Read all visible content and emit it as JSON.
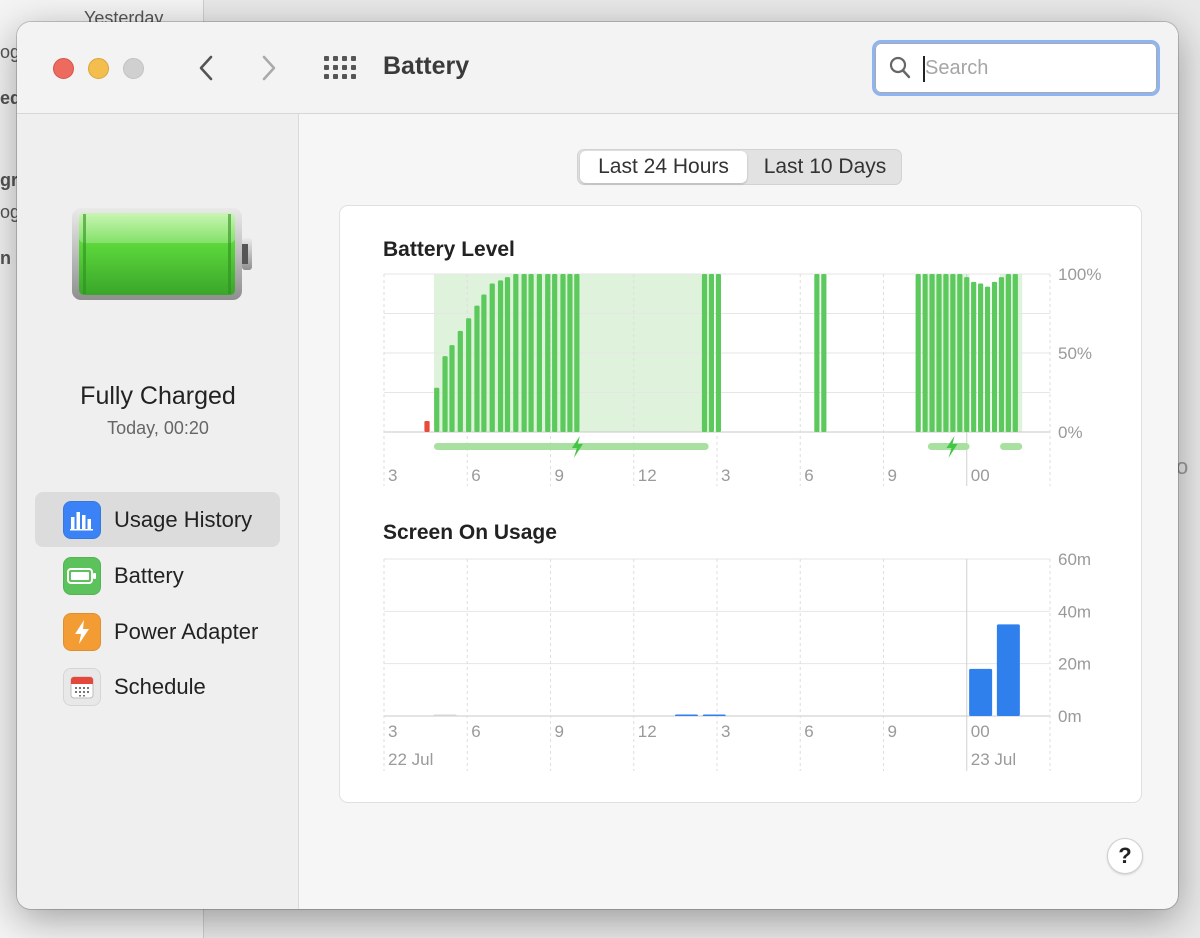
{
  "background": {
    "texts": [
      "Yesterday",
      "og",
      "ed",
      "gr",
      "og",
      "n",
      "o"
    ]
  },
  "window": {
    "title": "Battery",
    "search_placeholder": "Search"
  },
  "sidebar": {
    "status_title": "Fully Charged",
    "status_sub": "Today, 00:20",
    "items": [
      {
        "label": "Usage History",
        "icon": "bar-chart-icon",
        "color": "#3b82f6",
        "active": true
      },
      {
        "label": "Battery",
        "icon": "battery-icon",
        "color": "#5cc25c",
        "active": false
      },
      {
        "label": "Power Adapter",
        "icon": "lightning-icon",
        "color": "#f39c34",
        "active": false
      },
      {
        "label": "Schedule",
        "icon": "calendar-icon",
        "color": "#e8e8e8",
        "active": false
      }
    ]
  },
  "tabs": [
    "Last 24 Hours",
    "Last 10 Days"
  ],
  "help_label": "?",
  "chart_data": [
    {
      "type": "bar",
      "title": "Battery Level",
      "x_tick_labels": [
        "3",
        "6",
        "9",
        "12",
        "3",
        "6",
        "9",
        "00"
      ],
      "y_tick_labels": [
        "100%",
        "50%",
        "0%"
      ],
      "ylim": [
        0,
        100
      ],
      "color": "#5cc95c",
      "low_color": "#e94a3d",
      "charging_color": "#dff2dc",
      "bars": [
        {
          "x": 3.55,
          "v": 7,
          "low": true
        },
        {
          "x": 3.9,
          "v": 28
        },
        {
          "x": 4.2,
          "v": 48
        },
        {
          "x": 4.45,
          "v": 55
        },
        {
          "x": 4.75,
          "v": 64
        },
        {
          "x": 5.05,
          "v": 72
        },
        {
          "x": 5.35,
          "v": 80
        },
        {
          "x": 5.6,
          "v": 87
        },
        {
          "x": 5.9,
          "v": 94
        },
        {
          "x": 6.2,
          "v": 96
        },
        {
          "x": 6.45,
          "v": 98
        },
        {
          "x": 6.75,
          "v": 100
        },
        {
          "x": 7.05,
          "v": 100
        },
        {
          "x": 7.3,
          "v": 100
        },
        {
          "x": 7.6,
          "v": 100
        },
        {
          "x": 7.9,
          "v": 100
        },
        {
          "x": 8.15,
          "v": 100
        },
        {
          "x": 8.45,
          "v": 100
        },
        {
          "x": 8.7,
          "v": 100
        },
        {
          "x": 8.95,
          "v": 100
        },
        {
          "x": 13.55,
          "v": 100
        },
        {
          "x": 13.8,
          "v": 100
        },
        {
          "x": 14.05,
          "v": 100
        },
        {
          "x": 17.6,
          "v": 100
        },
        {
          "x": 17.85,
          "v": 100
        },
        {
          "x": 21.25,
          "v": 100
        },
        {
          "x": 21.5,
          "v": 100
        },
        {
          "x": 21.75,
          "v": 100
        },
        {
          "x": 22.0,
          "v": 100
        },
        {
          "x": 22.25,
          "v": 100
        },
        {
          "x": 22.5,
          "v": 100
        },
        {
          "x": 22.75,
          "v": 100
        },
        {
          "x": 23.0,
          "v": 98
        },
        {
          "x": 23.25,
          "v": 95
        },
        {
          "x": 23.5,
          "v": 94
        },
        {
          "x": 23.75,
          "v": 92
        },
        {
          "x": 24.0,
          "v": 95
        },
        {
          "x": 24.25,
          "v": 98
        },
        {
          "x": 24.5,
          "v": 100
        },
        {
          "x": 24.75,
          "v": 100
        }
      ],
      "charging_spans": [
        [
          3.8,
          13.7
        ],
        [
          21.6,
          23.1
        ],
        [
          24.2,
          25.0
        ]
      ],
      "charging_icon_at": [
        8.95,
        22.45
      ]
    },
    {
      "type": "bar",
      "title": "Screen On Usage",
      "x_tick_labels": [
        "3",
        "6",
        "9",
        "12",
        "3",
        "6",
        "9",
        "00"
      ],
      "date_labels": [
        "22 Jul",
        "23 Jul"
      ],
      "y_tick_labels": [
        "60m",
        "40m",
        "20m",
        "0m"
      ],
      "ylim": [
        0,
        60
      ],
      "color": "#2f80ed",
      "bars": [
        {
          "x": 4.2,
          "v": 0.3,
          "faint": true
        },
        {
          "x": 12.9,
          "v": 0.5
        },
        {
          "x": 13.9,
          "v": 0.5
        },
        {
          "x": 23.5,
          "v": 18
        },
        {
          "x": 24.5,
          "v": 35
        }
      ]
    }
  ]
}
